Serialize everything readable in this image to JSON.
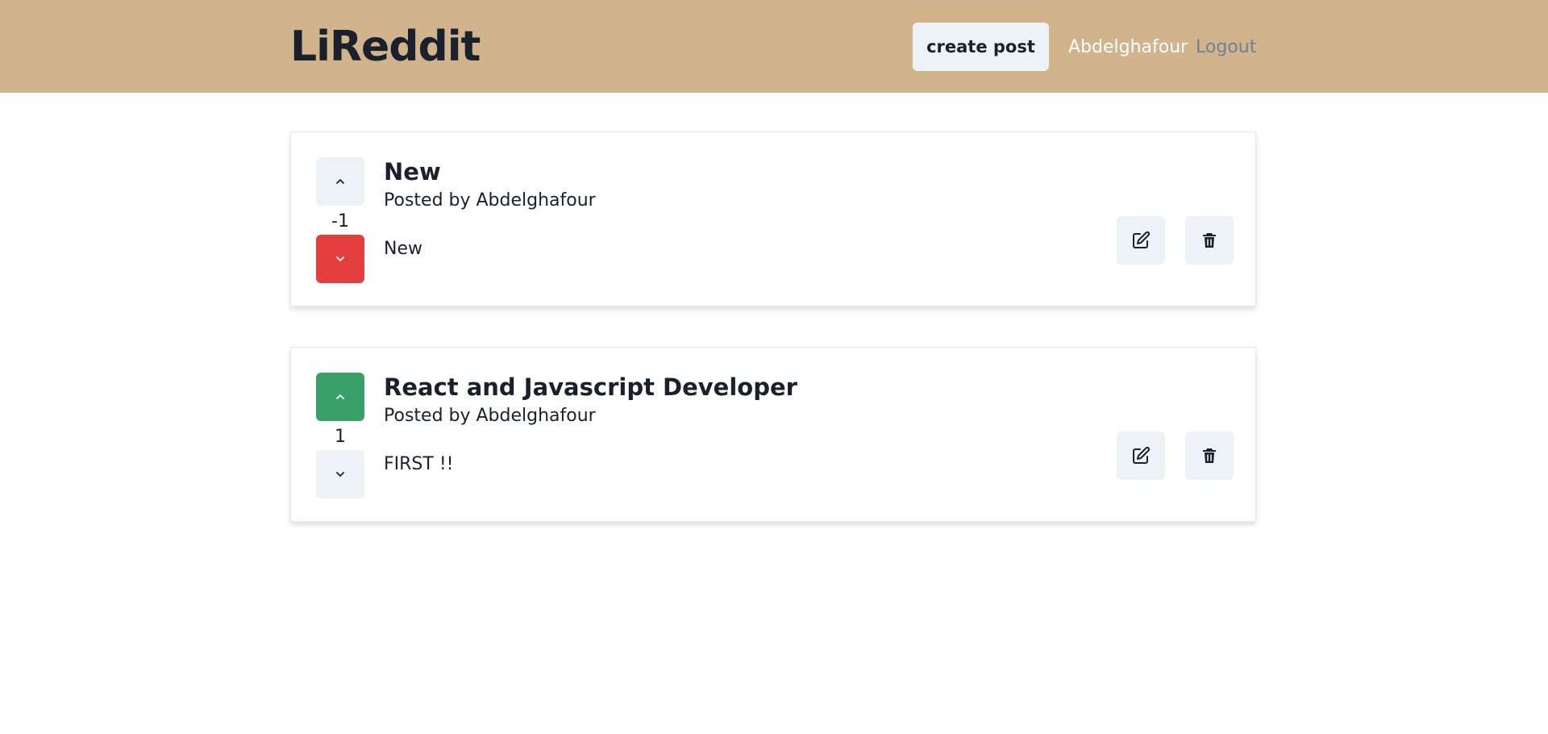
{
  "navbar": {
    "brand": "LiReddit",
    "create_post_label": "create post",
    "username": "Abdelghafour",
    "logout_label": "Logout",
    "background_color": "#d2b48c"
  },
  "posts": [
    {
      "title": "New",
      "author": "Posted by Abdelghafour",
      "text": "New",
      "points": "-1",
      "vote_state": "downvoted",
      "upvote_icon": "chevron-up-icon",
      "downvote_icon": "chevron-down-icon",
      "edit_icon": "edit-icon",
      "delete_icon": "trash-icon"
    },
    {
      "title": "React and Javascript Developer",
      "author": "Posted by Abdelghafour",
      "text": "FIRST !!",
      "points": "1",
      "vote_state": "upvoted",
      "upvote_icon": "chevron-up-icon",
      "downvote_icon": "chevron-down-icon",
      "edit_icon": "edit-icon",
      "delete_icon": "trash-icon"
    }
  ],
  "colors": {
    "upvote_active": "#38a169",
    "downvote_active": "#e53e3e",
    "button_default": "#edf2f7"
  }
}
